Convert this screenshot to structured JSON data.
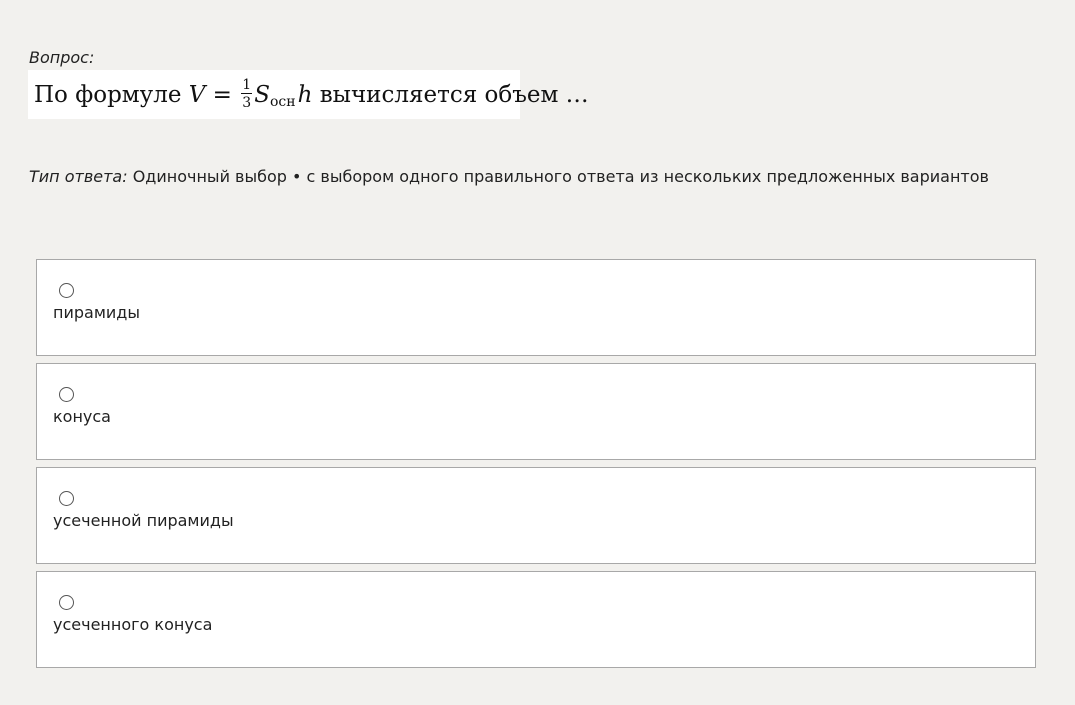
{
  "question": {
    "label": "Вопрос:",
    "formula": {
      "prefix": "По формуле ",
      "var_v": "V",
      "equals": " = ",
      "numerator": "1",
      "denominator": "3",
      "var_s": "S",
      "subscript": "осн",
      "var_h": "h",
      "suffix": " вычисляется объем …"
    }
  },
  "answer_type": {
    "label": "Тип ответа:",
    "value": " Одиночный выбор • с выбором одного правильного ответа из нескольких предложенных вариантов"
  },
  "options": [
    {
      "label": "пирамиды"
    },
    {
      "label": "конуса"
    },
    {
      "label": "усеченной пирамиды"
    },
    {
      "label": "усеченного конуса"
    }
  ]
}
